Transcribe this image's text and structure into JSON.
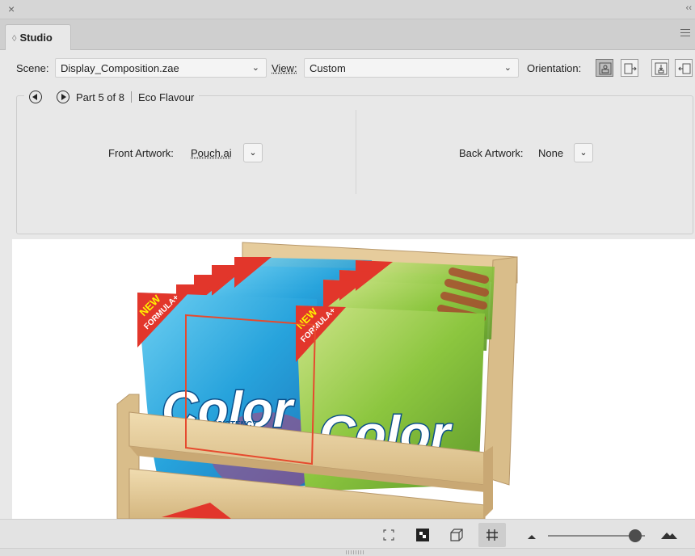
{
  "panel": {
    "close_glyph": "×",
    "collapse_glyph": "‹‹",
    "tab_title": "Studio",
    "tab_glyph": "◊"
  },
  "scene": {
    "label": "Scene:",
    "value": "Display_Composition.zae",
    "view_label": "View:",
    "view_value": "Custom",
    "orientation_label": "Orientation:",
    "orientation_icons": [
      "orientation-front-icon",
      "orientation-right-icon",
      "orientation-top-icon",
      "orientation-left-icon"
    ]
  },
  "part": {
    "prev_icon": "previous-icon",
    "next_icon": "next-icon",
    "position": "Part 5 of 8",
    "name": "Eco Flavour",
    "front_label": "Front Artwork:",
    "front_value": "Pouch.ai",
    "back_label": "Back Artwork:",
    "back_value": "None"
  },
  "viewport": {
    "brand_text": "Color",
    "sticker_line1": "NEW",
    "sticker_line2": "FORMULA+",
    "tagline": "CONSISTENCY",
    "colors": {
      "box": "#e6cc9c",
      "box_dark": "#c9a874",
      "pouch_blue": "#27a3dc",
      "pouch_green": "#8cc63f",
      "sticker_red": "#e2362b",
      "selection": "#e64a2e"
    }
  },
  "toolbar": {
    "icons": [
      "fit-view-icon",
      "texture-icon",
      "box-view-icon",
      "grid-icon"
    ],
    "zoom_level": 0.9
  }
}
